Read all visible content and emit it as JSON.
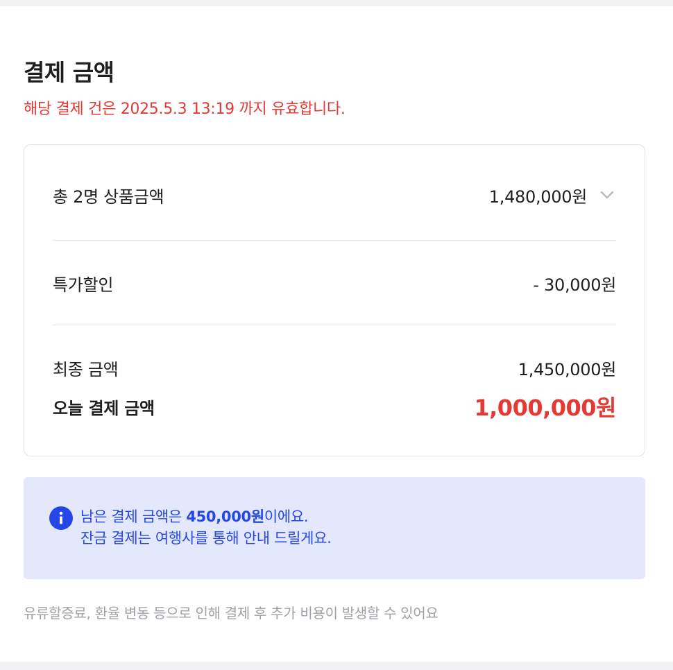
{
  "payment": {
    "title": "결제 금액",
    "validity_notice": "해당 결제 건은 2025.5.3 13:19 까지 유효합니다.",
    "accent_color": "#e53935"
  },
  "summary": {
    "product_total_label": "총 2명 상품금액",
    "product_total_value": "1,480,000원",
    "expand_icon": "chevron-down-icon",
    "discount_label": "특가할인",
    "discount_value": "- 30,000원",
    "final_label": "최종 금액",
    "final_value": "1,450,000원",
    "today_label": "오늘 결제 금액",
    "today_value": "1,000,000원"
  },
  "info": {
    "icon": "info-icon",
    "line1_prefix": "남은 결제 금액은 ",
    "line1_amount": "450,000원",
    "line1_suffix": "이에요.",
    "line2": "잔금 결제는 여행사를 통해 안내 드릴게요.",
    "background_color": "#e4e8fd",
    "text_color": "#2547e6"
  },
  "footnote": "유류할증료, 환율 변동 등으로 인해 결제 후 추가 비용이 발생할 수 있어요"
}
